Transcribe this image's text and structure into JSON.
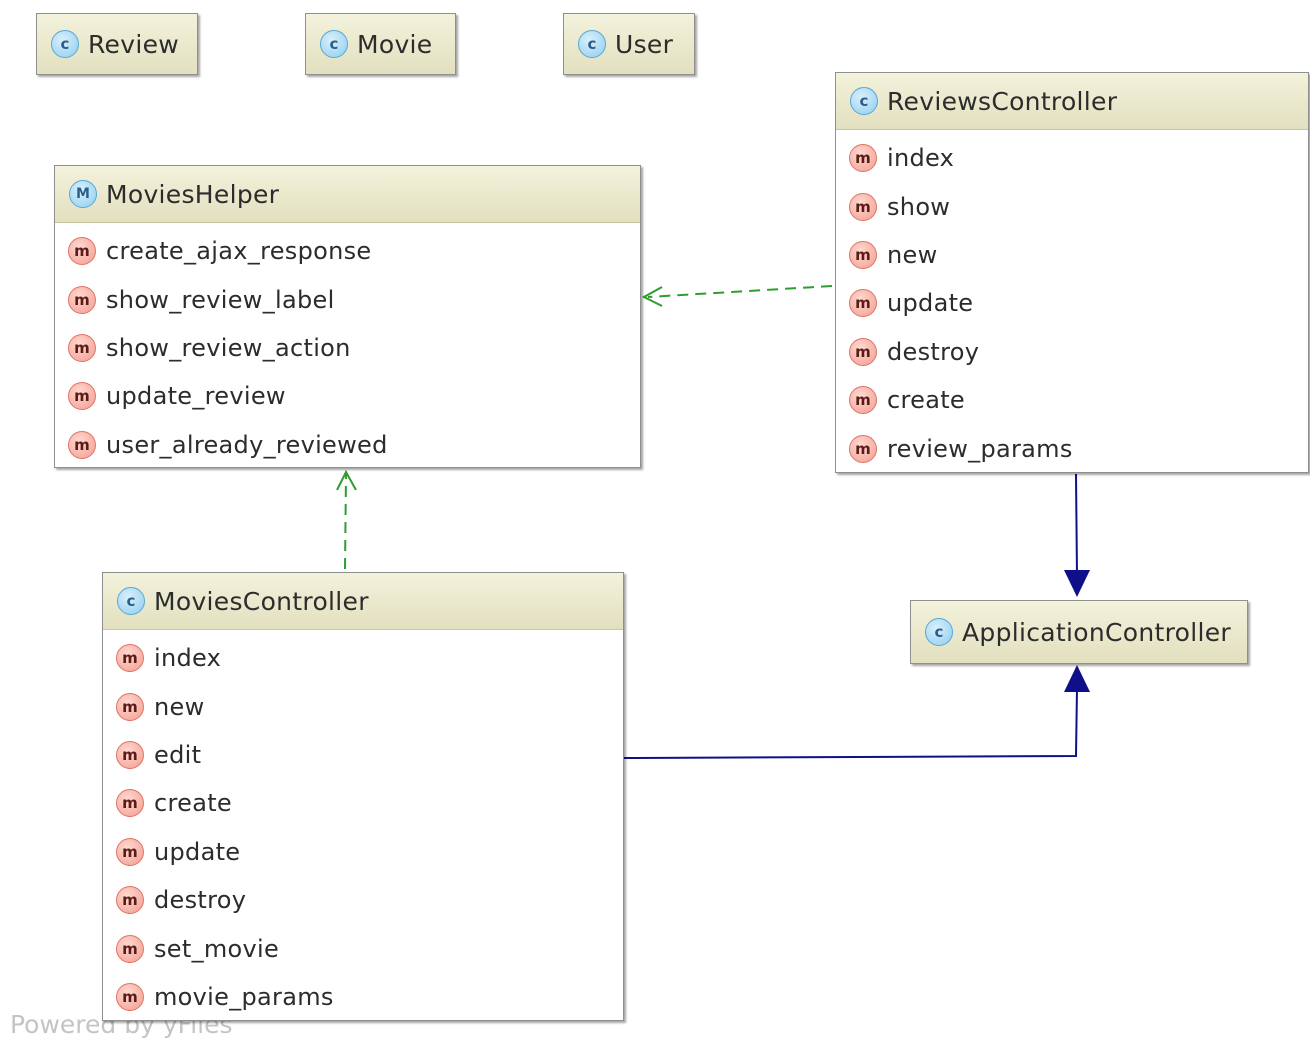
{
  "nodes": {
    "review": {
      "kind": "class",
      "badge": "c",
      "title": "Review"
    },
    "movie": {
      "kind": "class",
      "badge": "c",
      "title": "Movie"
    },
    "user": {
      "kind": "class",
      "badge": "c",
      "title": "User"
    },
    "reviews_controller": {
      "kind": "class",
      "badge": "c",
      "title": "ReviewsController",
      "methods": [
        "index",
        "show",
        "new",
        "update",
        "destroy",
        "create",
        "review_params"
      ]
    },
    "movies_helper": {
      "kind": "module",
      "badge": "M",
      "title": "MoviesHelper",
      "methods": [
        "create_ajax_response",
        "show_review_label",
        "show_review_action",
        "update_review",
        "user_already_reviewed"
      ]
    },
    "movies_controller": {
      "kind": "class",
      "badge": "c",
      "title": "MoviesController",
      "methods": [
        "index",
        "new",
        "edit",
        "create",
        "update",
        "destroy",
        "set_movie",
        "movie_params"
      ]
    },
    "application_controller": {
      "kind": "class",
      "badge": "c",
      "title": "ApplicationController"
    }
  },
  "method_badge": "m",
  "edges": [
    {
      "from": "ReviewsController",
      "to": "MoviesHelper",
      "type": "dependency",
      "style": "dashed",
      "color": "#2e9e2e"
    },
    {
      "from": "MoviesController",
      "to": "MoviesHelper",
      "type": "dependency",
      "style": "dashed",
      "color": "#2e9e2e"
    },
    {
      "from": "ReviewsController",
      "to": "ApplicationController",
      "type": "inheritance",
      "style": "solid",
      "color": "#0f0f8a"
    },
    {
      "from": "MoviesController",
      "to": "ApplicationController",
      "type": "inheritance",
      "style": "solid",
      "color": "#0f0f8a"
    }
  ],
  "colors": {
    "header_fill": "#e9e7c9",
    "class_badge": "#8ecdf0",
    "method_badge": "#f29c8f",
    "dependency_edge": "#2e9e2e",
    "inheritance_edge": "#0f0f8a"
  },
  "footer": "Powered by yFiles"
}
